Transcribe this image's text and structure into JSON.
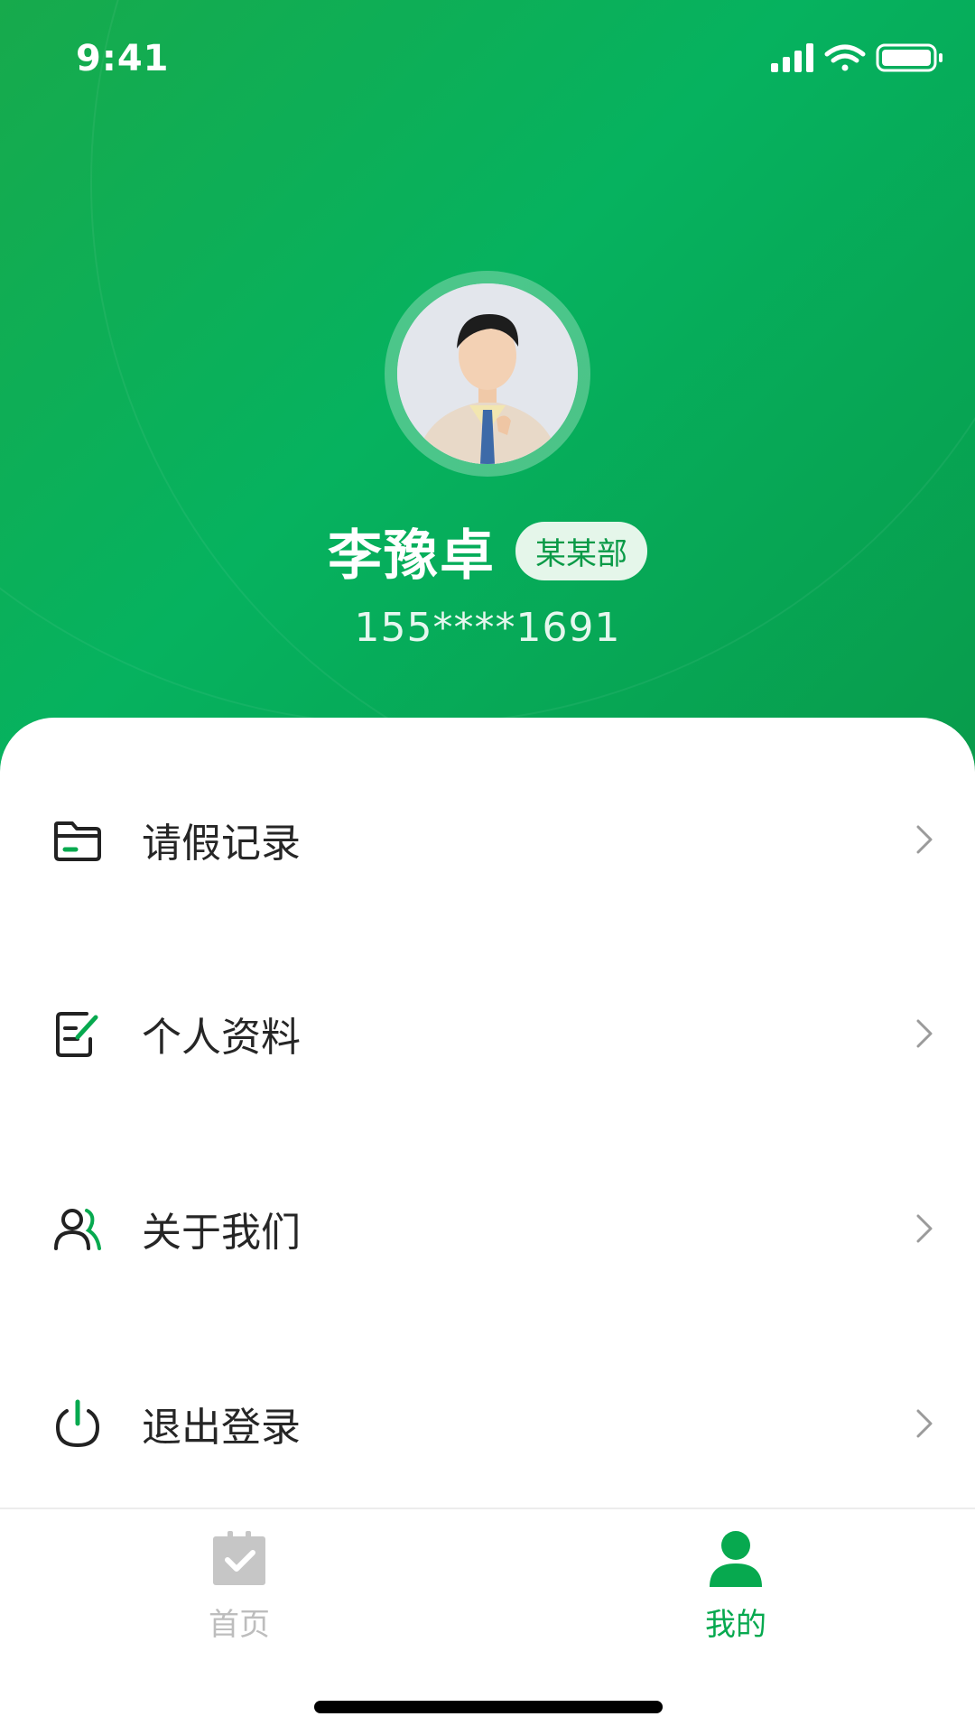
{
  "status_bar": {
    "time": "9:41"
  },
  "profile": {
    "name": "李豫卓",
    "department": "某某部",
    "phone": "155****1691",
    "avatar": "person-photo"
  },
  "menu": [
    {
      "label": "请假记录",
      "icon": "folder-icon"
    },
    {
      "label": "个人资料",
      "icon": "edit-document-icon"
    },
    {
      "label": "关于我们",
      "icon": "users-icon"
    },
    {
      "label": "退出登录",
      "icon": "power-icon"
    }
  ],
  "tabbar": {
    "items": [
      {
        "label": "首页",
        "icon": "calendar-check-icon",
        "active": false
      },
      {
        "label": "我的",
        "icon": "user-icon",
        "active": true
      }
    ]
  },
  "colors": {
    "brand_green": "#07a94f",
    "active_tab": "#07a94f",
    "inactive_tab": "#bdbdbd",
    "text_primary": "#262626"
  }
}
